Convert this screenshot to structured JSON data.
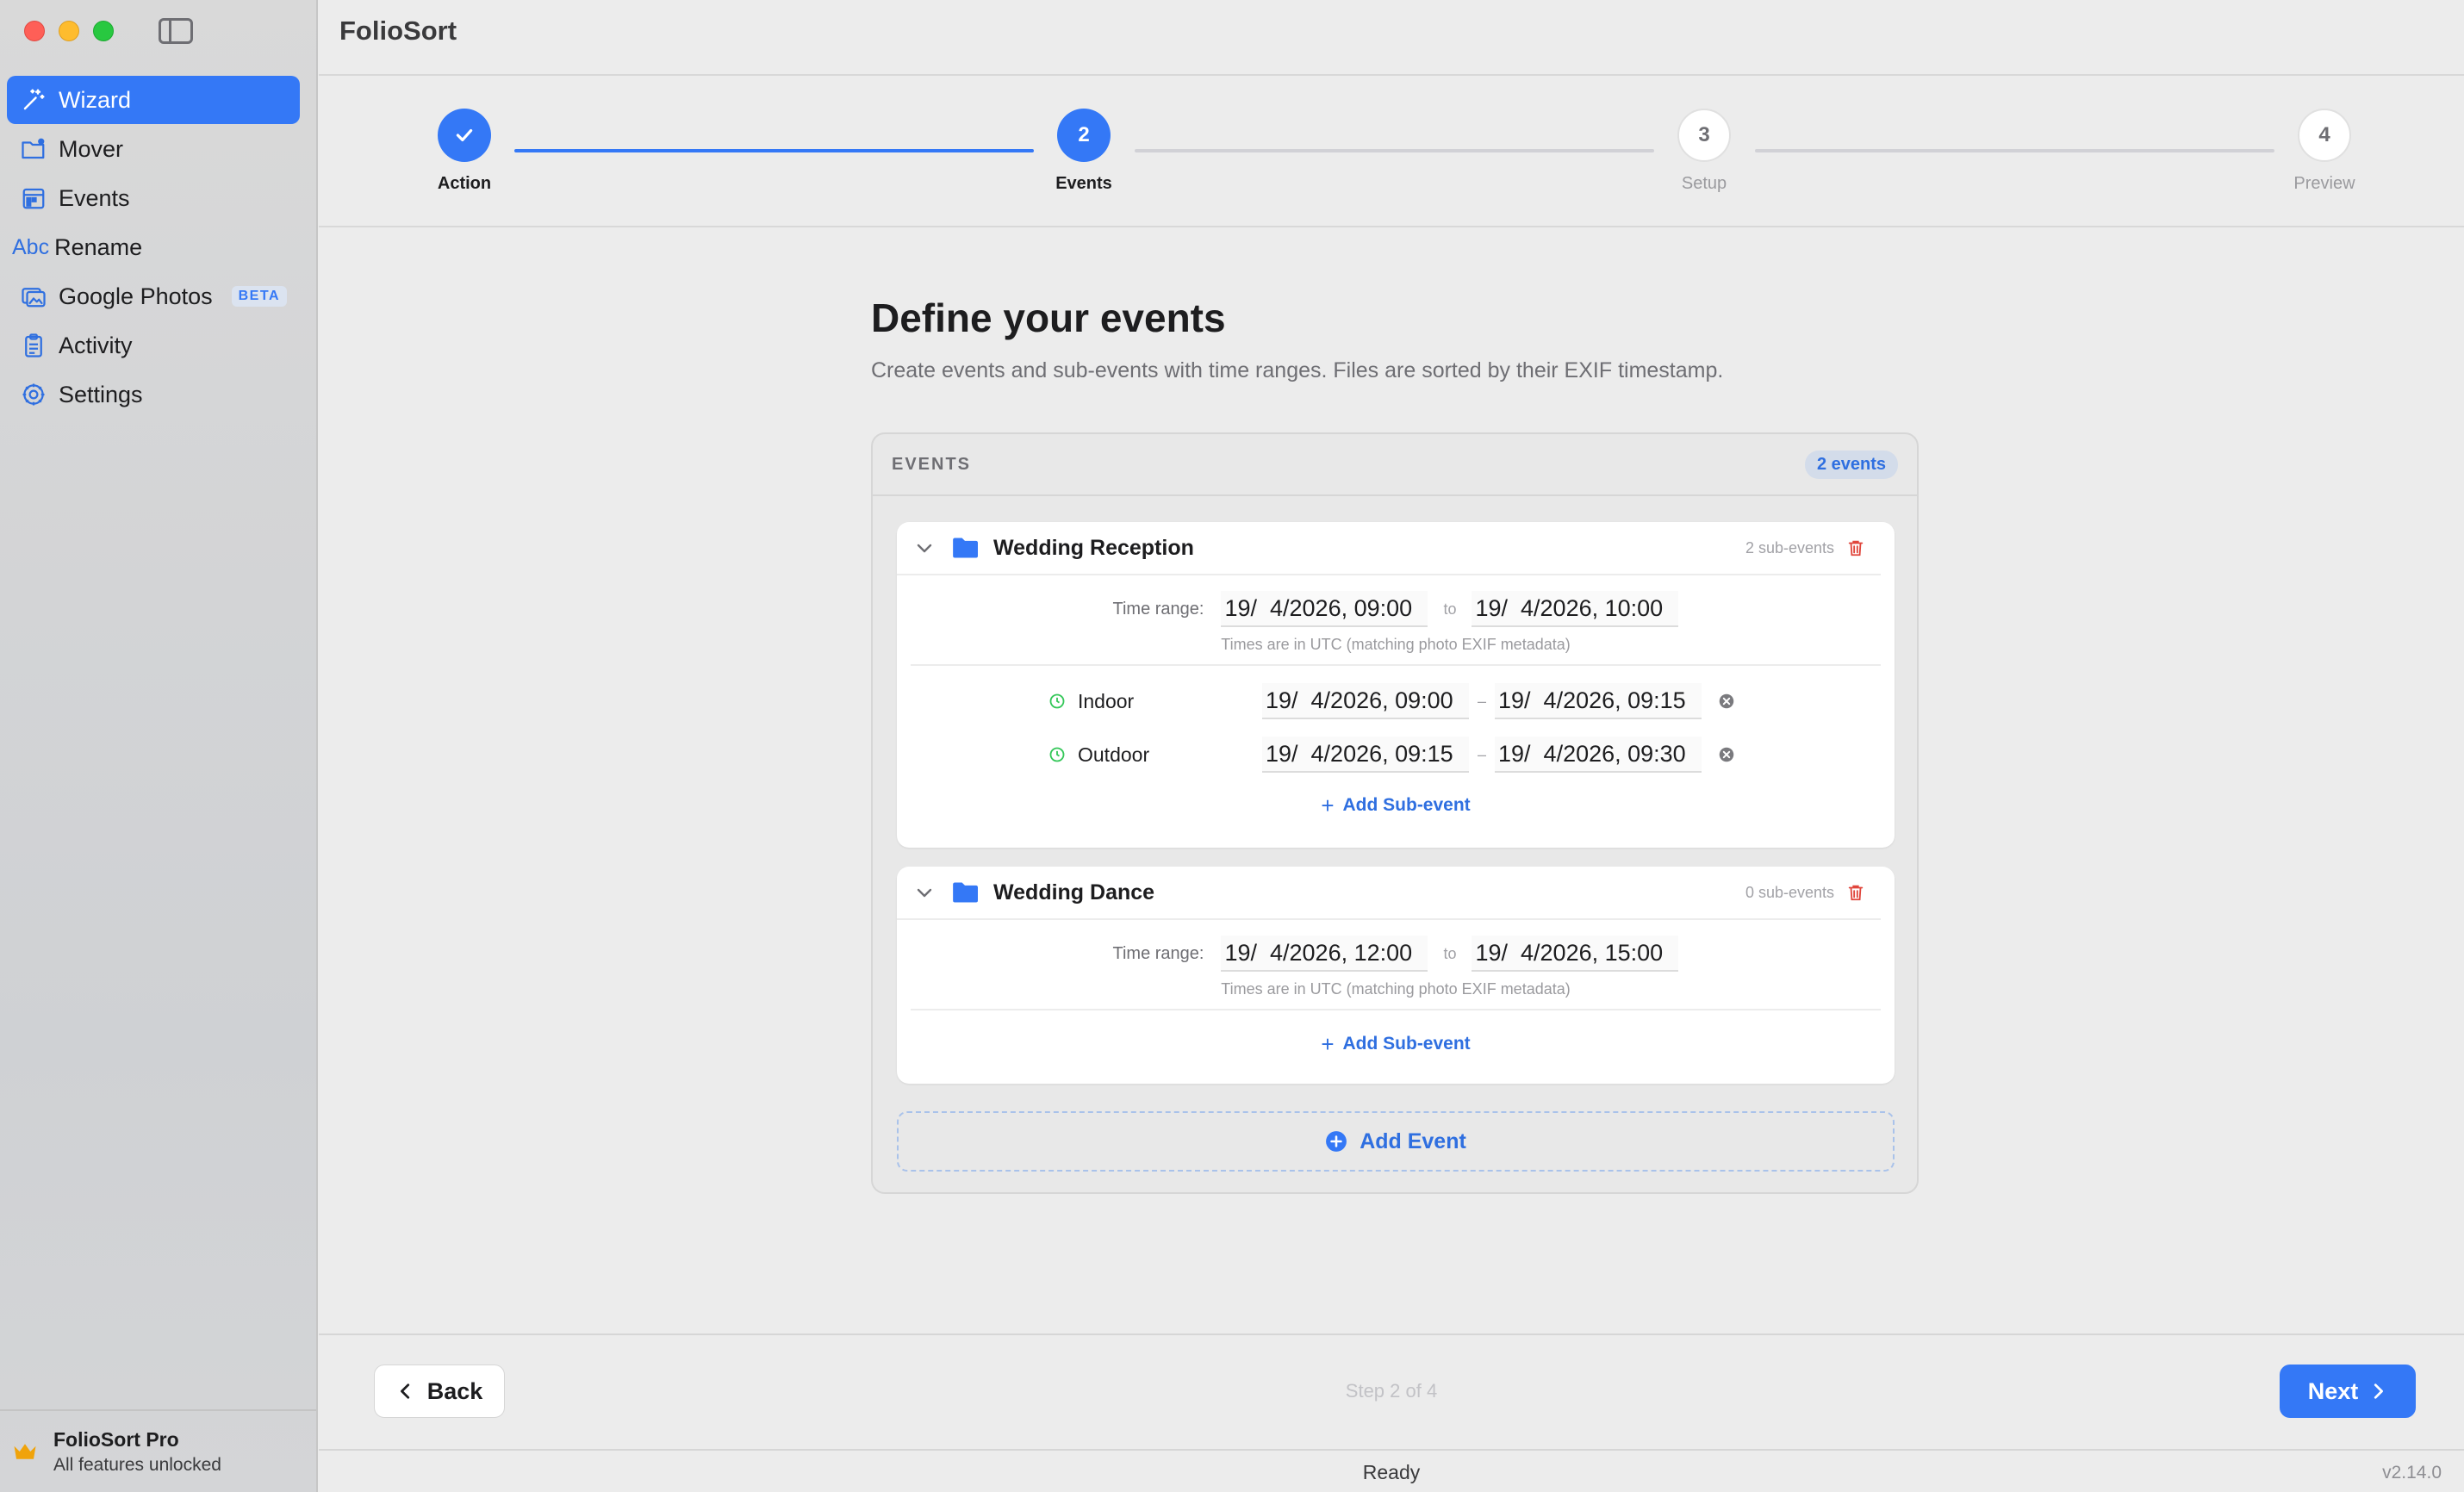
{
  "app": {
    "title": "FolioSort",
    "version": "v2.14.0"
  },
  "sidebar": {
    "items": [
      {
        "label": "Wizard",
        "icon": "magic-wand-icon",
        "active": true
      },
      {
        "label": "Mover",
        "icon": "folder-move-icon"
      },
      {
        "label": "Events",
        "icon": "calendar-icon"
      },
      {
        "label": "Rename",
        "icon": "abc-text-icon",
        "icon_text": "Abc"
      },
      {
        "label": "Google Photos",
        "icon": "photos-icon",
        "badge": "BETA"
      },
      {
        "label": "Activity",
        "icon": "clipboard-icon"
      },
      {
        "label": "Settings",
        "icon": "gear-icon"
      }
    ],
    "footer": {
      "title": "FolioSort Pro",
      "subtitle": "All features unlocked"
    }
  },
  "stepper": {
    "steps": [
      {
        "number": "✓",
        "label": "Action",
        "state": "done"
      },
      {
        "number": "2",
        "label": "Events",
        "state": "current"
      },
      {
        "number": "3",
        "label": "Setup",
        "state": "todo"
      },
      {
        "number": "4",
        "label": "Preview",
        "state": "todo"
      }
    ]
  },
  "main": {
    "heading": "Define your events",
    "subheading": "Create events and sub-events with time ranges. Files are sorted by their EXIF timestamp."
  },
  "events_panel": {
    "title": "EVENTS",
    "count": "2 events",
    "time_range_label": "Time range:",
    "to_label": "to",
    "dash": "–",
    "utc_note": "Times are in UTC (matching photo EXIF metadata)",
    "add_sub_label": "Add Sub-event",
    "add_event_label": "Add Event",
    "events": [
      {
        "name": "Wedding Reception",
        "sub_count": "2 sub-events",
        "start": "19/  4/2026, 09:00",
        "end": "19/  4/2026, 10:00",
        "sub_events": [
          {
            "name": "Indoor",
            "start": "19/  4/2026, 09:00",
            "end": "19/  4/2026, 09:15"
          },
          {
            "name": "Outdoor",
            "start": "19/  4/2026, 09:15",
            "end": "19/  4/2026, 09:30"
          }
        ]
      },
      {
        "name": "Wedding Dance",
        "sub_count": "0 sub-events",
        "start": "19/  4/2026, 12:00",
        "end": "19/  4/2026, 15:00",
        "sub_events": []
      }
    ]
  },
  "footer": {
    "back_label": "Back",
    "next_label": "Next",
    "step_indicator": "Step 2 of 4"
  },
  "status": {
    "text": "Ready"
  },
  "colors": {
    "accent": "#3478f6",
    "danger": "#e0453b",
    "success": "#34c759"
  }
}
